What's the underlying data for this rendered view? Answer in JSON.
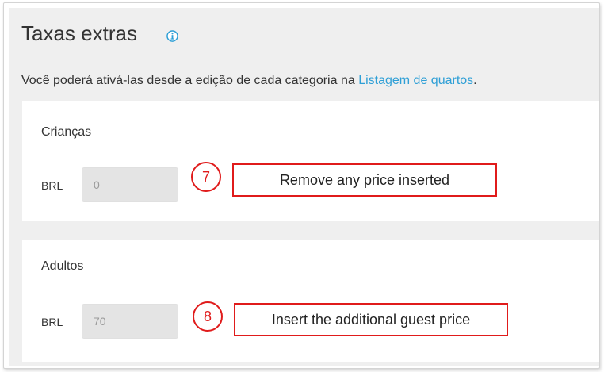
{
  "section": {
    "title": "Taxas extras",
    "info_icon": "info-icon",
    "description": "Você poderá ativá-las desde a edição de cada categoria na ",
    "description_link": "Listagem de quartos",
    "description_end": "."
  },
  "children": {
    "label": "Crianças",
    "currency": "BRL",
    "value": "0"
  },
  "adults": {
    "label": "Adultos",
    "currency": "BRL",
    "value": "70"
  },
  "annotations": [
    {
      "number": "7",
      "text": "Remove any price inserted"
    },
    {
      "number": "8",
      "text": "Insert the additional guest price"
    }
  ],
  "colors": {
    "link": "#2e9fd6",
    "annotation": "#e01b1b",
    "panel_bg": "#efefef",
    "input_bg": "#e4e4e4"
  }
}
